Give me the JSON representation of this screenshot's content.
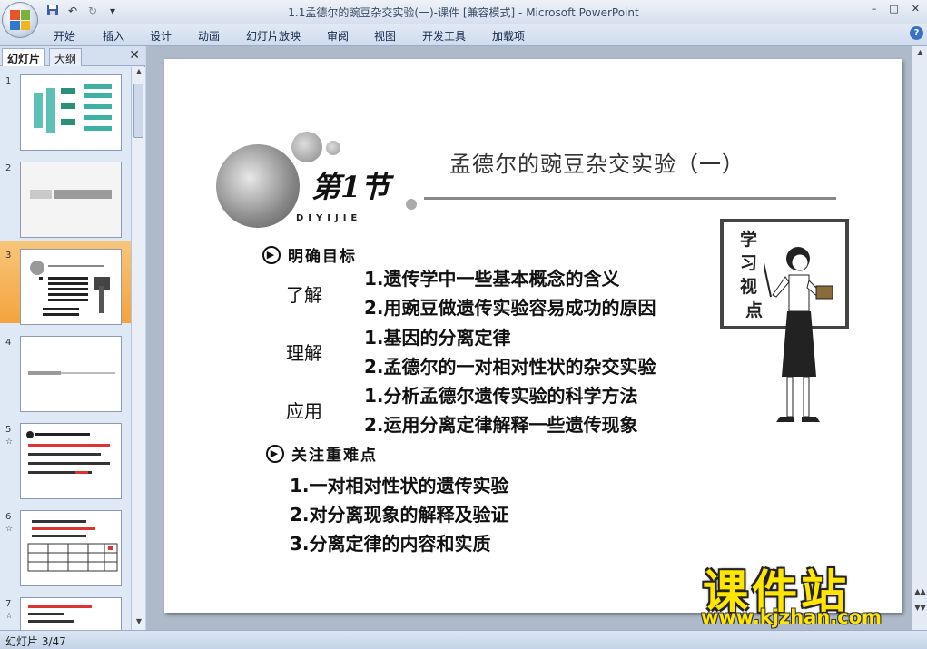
{
  "app": {
    "window_title": "1.1孟德尔的豌豆杂交实验(一)-课件 [兼容模式] - Microsoft PowerPoint",
    "qat": {
      "save_icon": "save-icon",
      "undo": "↶",
      "redo": "↻",
      "more": "▾"
    },
    "window_controls": {
      "minimize": "–",
      "restore": "□",
      "close": "✕"
    }
  },
  "ribbon": {
    "tabs": [
      "开始",
      "插入",
      "设计",
      "动画",
      "幻灯片放映",
      "审阅",
      "视图",
      "开发工具",
      "加载项"
    ],
    "help": "?"
  },
  "panel": {
    "tabs": [
      "幻灯片",
      "大纲"
    ],
    "close": "✕",
    "slides": [
      {
        "num": "1",
        "anim": ""
      },
      {
        "num": "2",
        "anim": ""
      },
      {
        "num": "3",
        "anim": ""
      },
      {
        "num": "4",
        "anim": ""
      },
      {
        "num": "5",
        "anim": "☆"
      },
      {
        "num": "6",
        "anim": "☆"
      },
      {
        "num": "7",
        "anim": "☆"
      }
    ],
    "selected": "3"
  },
  "slide": {
    "section_badge": "第1节",
    "section_pinyin": "DIYIJIE",
    "title": "孟德尔的豌豆杂交实验（一）",
    "goals_heading": "明确目标",
    "rows": [
      {
        "label": "了解",
        "items": [
          "1.遗传学中一些基本概念的含义",
          "2.用豌豆做遗传实验容易成功的原因"
        ]
      },
      {
        "label": "理解",
        "items": [
          "1.基因的分离定律",
          "2.孟德尔的一对相对性状的杂交实验"
        ]
      },
      {
        "label": "应用",
        "items": [
          "1.分析孟德尔遗传实验的科学方法",
          "2.运用分离定律解释一些遗传现象"
        ]
      }
    ],
    "focus_heading": "关注重难点",
    "focus_items": [
      "1.一对相对性状的遗传实验",
      "2.对分离现象的解释及验证",
      "3.分离定律的内容和实质"
    ],
    "board_text": [
      "学",
      "习",
      "视",
      "点"
    ]
  },
  "status": {
    "slide_counter": "幻灯片 3/47"
  },
  "watermark": {
    "brand": "课件站",
    "url": "www.kjzhan.com"
  }
}
